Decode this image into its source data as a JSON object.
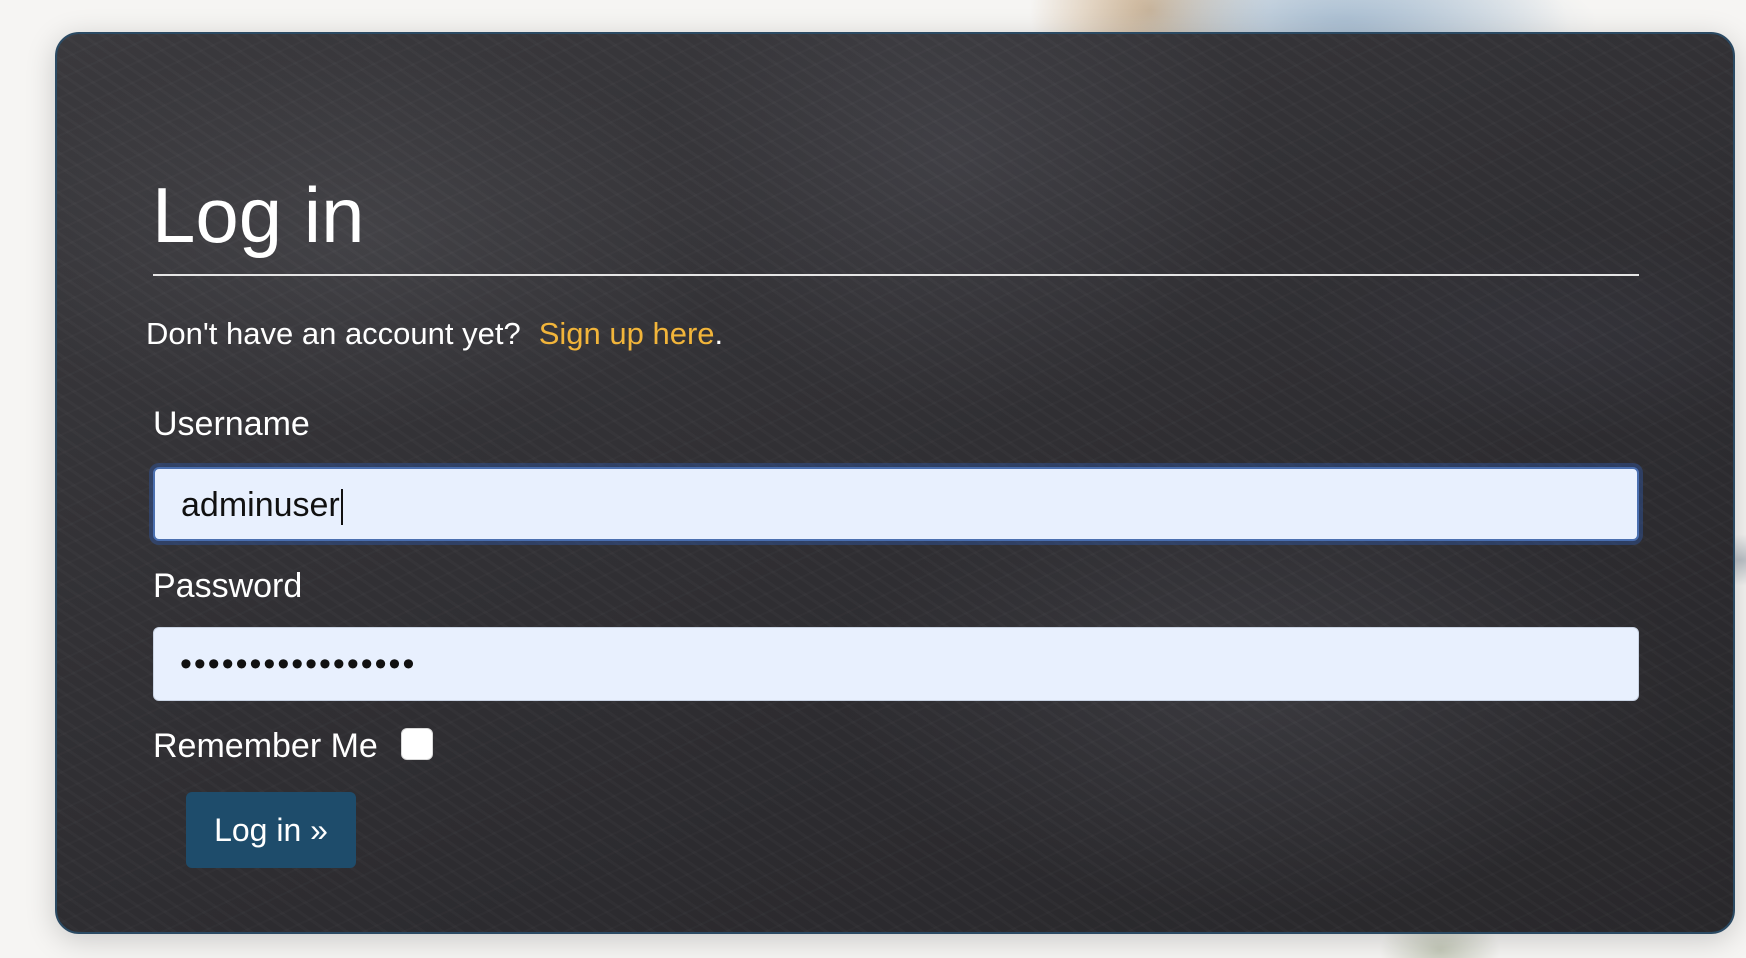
{
  "login": {
    "title": "Log in",
    "signup_prompt": "Don't have an account yet?",
    "signup_link": "Sign up here",
    "signup_suffix": ".",
    "username_label": "Username",
    "username_value": "adminuser",
    "password_label": "Password",
    "password_value": "•••••••••••••••••",
    "remember_label": "Remember Me",
    "remember_checked": false,
    "submit_label": "Log in »"
  },
  "colors": {
    "link": "#f2b53a",
    "button": "#1e4c6b",
    "input_bg": "#e8f0fe",
    "card_bg": "#323135"
  }
}
